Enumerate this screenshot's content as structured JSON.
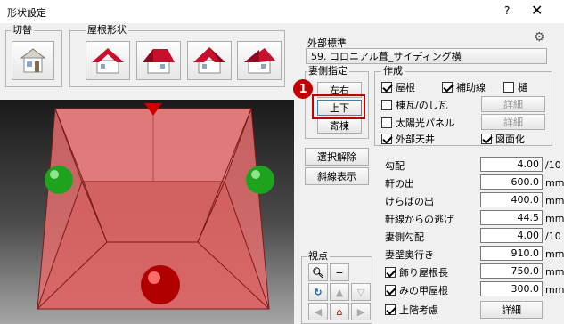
{
  "window": {
    "title": "形状設定",
    "help": "?",
    "close": "✕"
  },
  "switch_group": {
    "label": "切替"
  },
  "roof_shape_group": {
    "label": "屋根形状"
  },
  "gable_group": {
    "label": "妻側指定",
    "buttons": [
      "左右",
      "上下",
      "寄棟"
    ]
  },
  "clear_button": "選択解除",
  "slope_button": "斜線表示",
  "viewpoint_group": {
    "label": "視点"
  },
  "exterior": {
    "label": "外部標準",
    "value": "59. コロニアル葺_サイディング横"
  },
  "create_group": {
    "label": "作成",
    "items": [
      {
        "label": "屋根",
        "checked": true,
        "enabled": true
      },
      {
        "label": "補助線",
        "checked": true,
        "enabled": true
      },
      {
        "label": "樋",
        "checked": false,
        "enabled": true
      },
      {
        "label": "棟瓦/のし瓦",
        "checked": false,
        "enabled": true
      },
      {
        "label": "太陽光パネル",
        "checked": false,
        "enabled": true
      },
      {
        "label": "外部天井",
        "checked": true,
        "enabled": true
      },
      {
        "label": "図面化",
        "checked": true,
        "enabled": true
      }
    ],
    "detail_label": "詳細"
  },
  "params": [
    {
      "label": "勾配",
      "value": "4.00",
      "unit": "/10"
    },
    {
      "label": "軒の出",
      "value": "600.0",
      "unit": "mm"
    },
    {
      "label": "けらばの出",
      "value": "400.0",
      "unit": "mm"
    },
    {
      "label": "軒線からの逃げ",
      "value": "44.5",
      "unit": "mm"
    },
    {
      "label": "妻側勾配",
      "value": "4.00",
      "unit": "/10"
    },
    {
      "label": "妻壁奥行き",
      "value": "910.0",
      "unit": "mm"
    },
    {
      "label": "飾り屋根長",
      "value": "750.0",
      "unit": "mm",
      "checked": true
    },
    {
      "label": "みの甲屋根",
      "value": "300.0",
      "unit": "mm",
      "checked": true
    },
    {
      "label": "上階考慮",
      "checked": true
    }
  ],
  "detail_button": "詳細",
  "callout": "1",
  "colors": {
    "accent_red": "#c00000",
    "roof_fill": "#e87474",
    "sphere_green": "#1fa31f",
    "sphere_red": "#c00000"
  }
}
